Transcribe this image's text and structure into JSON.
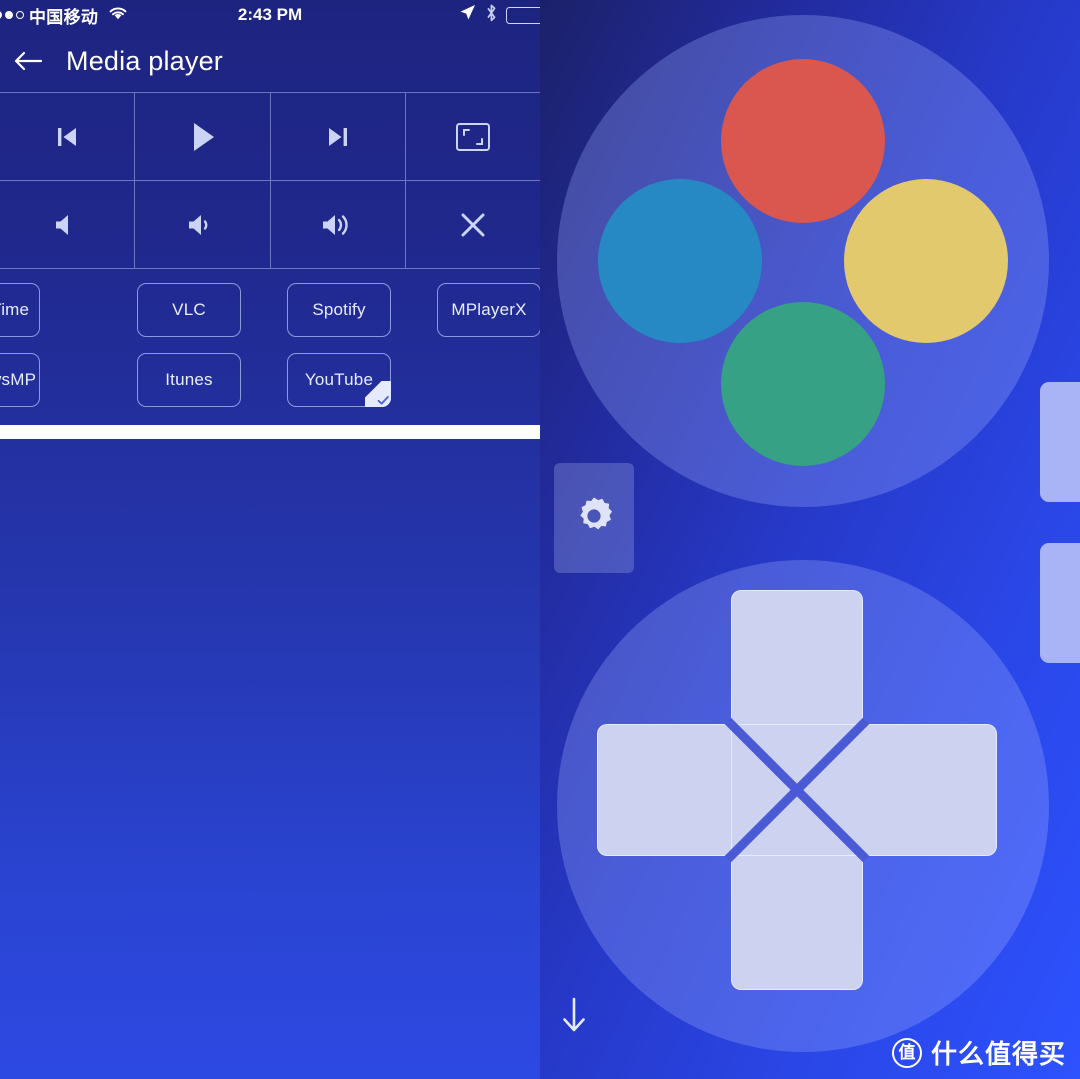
{
  "left": {
    "statusbar": {
      "carrier": "中国移动",
      "time": "2:43 PM",
      "wifi_icon": "wifi-icon",
      "location_icon": "location-arrow-icon",
      "bluetooth_icon": "bluetooth-icon",
      "battery_icon": "battery-icon",
      "battery_color": "#3ddc5b"
    },
    "titlebar": {
      "back_icon": "back-arrow-icon",
      "title": "Media player"
    },
    "media_controls": [
      {
        "name": "previous-track",
        "icon": "skip-previous-icon"
      },
      {
        "name": "play",
        "icon": "play-icon"
      },
      {
        "name": "next-track",
        "icon": "skip-next-icon"
      },
      {
        "name": "fullscreen",
        "icon": "fullscreen-icon"
      },
      {
        "name": "mute",
        "icon": "volume-mute-icon"
      },
      {
        "name": "volume-down",
        "icon": "volume-low-icon"
      },
      {
        "name": "volume-up",
        "icon": "volume-high-icon"
      },
      {
        "name": "close",
        "icon": "close-icon"
      }
    ],
    "apps": [
      {
        "label": "QuickTime",
        "selected": false
      },
      {
        "label": "VLC",
        "selected": false
      },
      {
        "label": "Spotify",
        "selected": false
      },
      {
        "label": "MPlayerX",
        "selected": false
      },
      {
        "label": "WindowsMP",
        "selected": false
      },
      {
        "label": "Itunes",
        "selected": false
      },
      {
        "label": "YouTube",
        "selected": true
      }
    ]
  },
  "right": {
    "action_buttons": [
      {
        "name": "action-button-up",
        "color": "#d9574f",
        "position": "top"
      },
      {
        "name": "action-button-left",
        "color": "#2689c4",
        "position": "left"
      },
      {
        "name": "action-button-right",
        "color": "#e3c96e",
        "position": "right"
      },
      {
        "name": "action-button-down",
        "color": "#36a184",
        "position": "bottom"
      }
    ],
    "settings_icon": "gear-icon",
    "dpad_icon": "dpad-icon",
    "shoulder_buttons": [
      {
        "name": "shoulder-button-1"
      },
      {
        "name": "shoulder-button-2"
      }
    ],
    "scroll_down_icon": "arrow-down-icon",
    "watermark": {
      "badge": "值",
      "text": "什么值得买"
    }
  }
}
